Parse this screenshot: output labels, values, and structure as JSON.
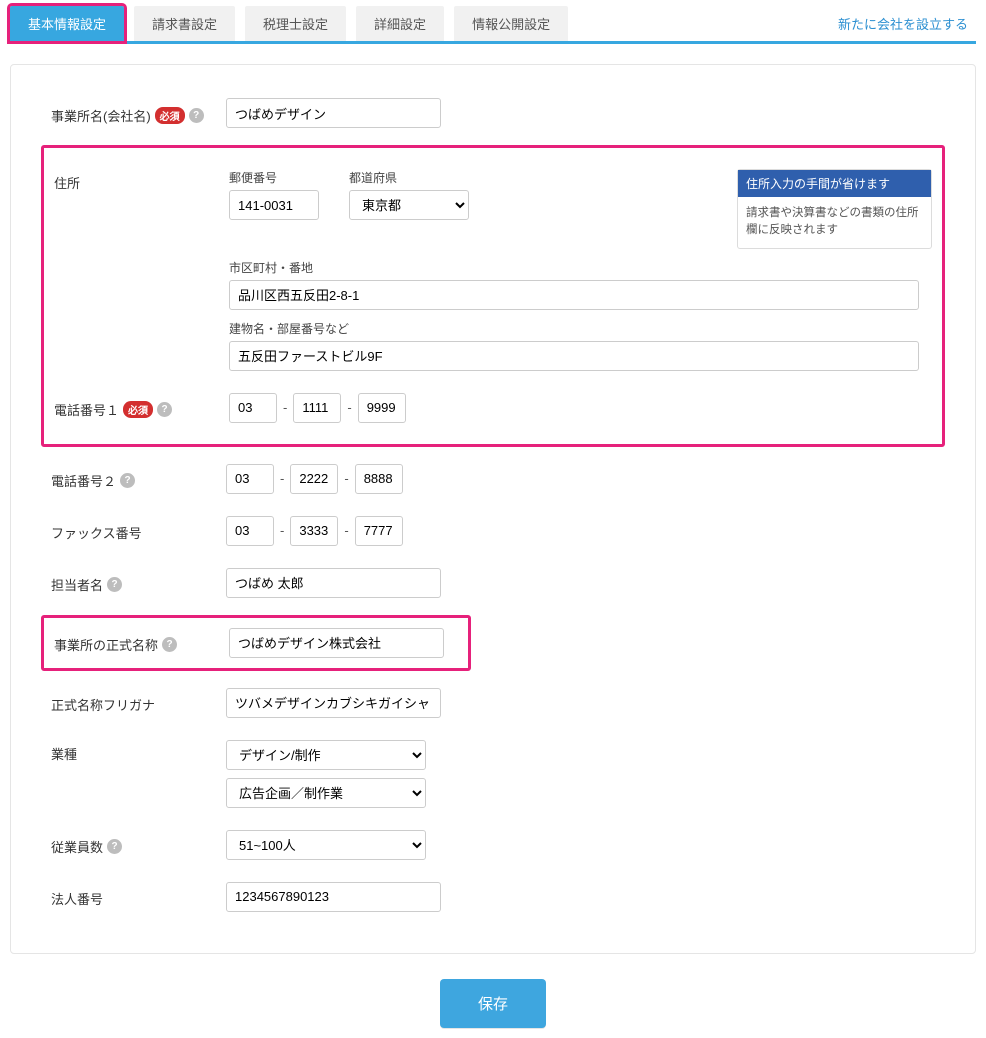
{
  "tabs": [
    "基本情報設定",
    "請求書設定",
    "税理士設定",
    "詳細設定",
    "情報公開設定"
  ],
  "topLink": "新たに会社を設立する",
  "labels": {
    "companyName": "事業所名(会社名)",
    "address": "住所",
    "postal": "郵便番号",
    "prefecture": "都道府県",
    "city": "市区町村・番地",
    "building": "建物名・部屋番号など",
    "phone1": "電話番号１",
    "phone2": "電話番号２",
    "fax": "ファックス番号",
    "contact": "担当者名",
    "officialName": "事業所の正式名称",
    "officialKana": "正式名称フリガナ",
    "industry": "業種",
    "employees": "従業員数",
    "corpNumber": "法人番号"
  },
  "values": {
    "companyName": "つばめデザイン",
    "postal": "141-0031",
    "prefecture": "東京都",
    "city": "品川区西五反田2-8-1",
    "building": "五反田ファーストビル9F",
    "phone1": [
      "03",
      "1111",
      "9999"
    ],
    "phone2": [
      "03",
      "2222",
      "8888"
    ],
    "fax": [
      "03",
      "3333",
      "7777"
    ],
    "contact": "つばめ 太郎",
    "officialName": "つばめデザイン株式会社",
    "officialKana": "ツバメデザインカブシキガイシャ",
    "industry1": "デザイン/制作",
    "industry2": "広告企画／制作業",
    "employees": "51~100人",
    "corpNumber": "1234567890123"
  },
  "required": "必須",
  "note": {
    "title": "住所入力の手間が省けます",
    "body": "請求書や決算書などの書類の住所欄に反映されます"
  },
  "saveLabel": "保存",
  "sep": "-"
}
